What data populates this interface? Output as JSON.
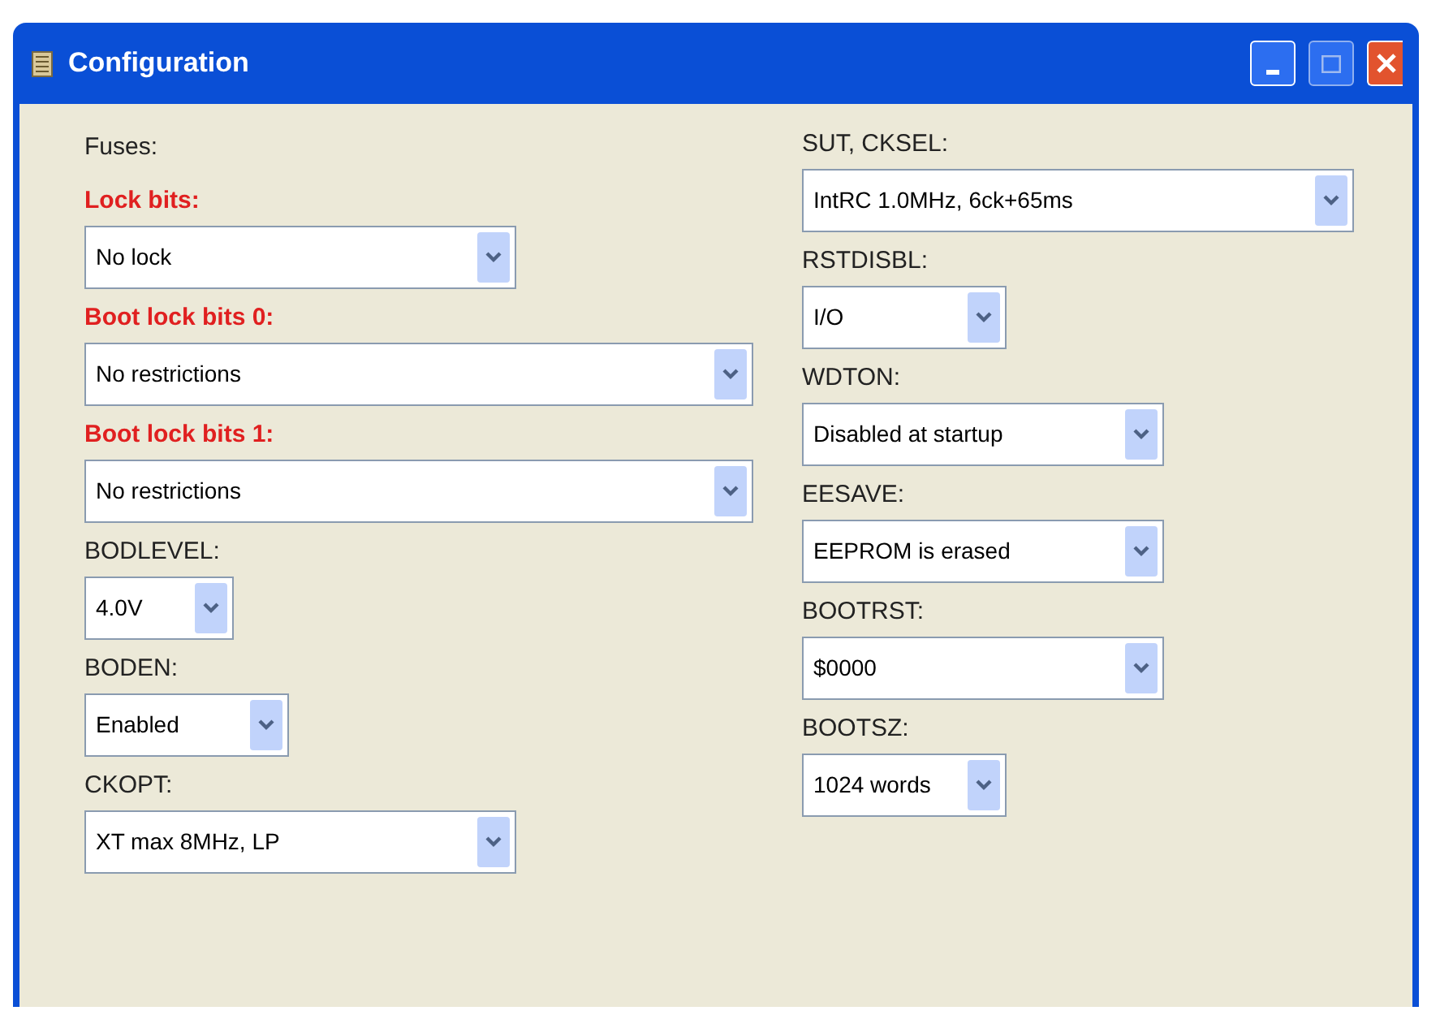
{
  "window": {
    "title": "Configuration"
  },
  "heading": "Fuses:",
  "left": [
    {
      "label": "Lock bits:",
      "kind": "lock",
      "value": "No lock"
    },
    {
      "label": "Boot lock bits 0:",
      "kind": "lock",
      "value": "No restrictions"
    },
    {
      "label": "Boot lock bits 1:",
      "kind": "lock",
      "value": "No restrictions"
    },
    {
      "label": "BODLEVEL:",
      "kind": "fuse",
      "value": "4.0V"
    },
    {
      "label": "BODEN:",
      "kind": "fuse",
      "value": "Enabled"
    },
    {
      "label": "CKOPT:",
      "kind": "fuse",
      "value": "XT max 8MHz, LP"
    }
  ],
  "right": [
    {
      "label": "SUT, CKSEL:",
      "kind": "fuse",
      "value": "IntRC 1.0MHz, 6ck+65ms"
    },
    {
      "label": "RSTDISBL:",
      "kind": "fuse",
      "value": "I/O"
    },
    {
      "label": "WDTON:",
      "kind": "fuse",
      "value": "Disabled at startup"
    },
    {
      "label": "EESAVE:",
      "kind": "fuse",
      "value": "EEPROM is erased"
    },
    {
      "label": "BOOTRST:",
      "kind": "fuse",
      "value": "$0000"
    },
    {
      "label": "BOOTSZ:",
      "kind": "fuse",
      "value": "1024 words"
    }
  ]
}
